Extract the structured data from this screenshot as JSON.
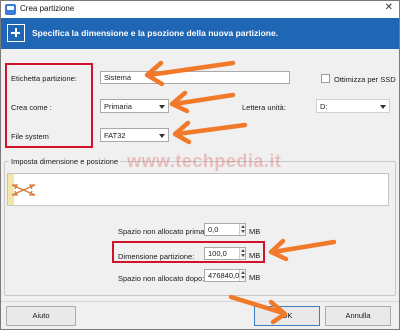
{
  "window": {
    "title": "Crea partizione"
  },
  "banner": {
    "text": "Specifica la dimensione e la psozione della nuova partizione."
  },
  "form": {
    "label_partition": "Etichetta partizione:",
    "label_partition_value": "Sistema",
    "ssd_label": "Ottimizza per SSD",
    "create_as_label": "Crea come :",
    "create_as_value": "Primaria",
    "drive_letter_label": "Lettera unità:",
    "drive_letter_value": "D:",
    "filesystem_label": "File system",
    "filesystem_value": "FAT32"
  },
  "size_group": {
    "title": "Imposta dimensione e posizione",
    "unalloc_before_label": "Spazio non allocato prima:",
    "unalloc_before_value": "0,0",
    "unalloc_before_unit": "MB",
    "partition_size_label": "Dimensione partizione:",
    "partition_size_value": "100,0",
    "partition_size_unit": "MB",
    "unalloc_after_label": "Spazio non allocato dopo:",
    "unalloc_after_value": "476840,0",
    "unalloc_after_unit": "MB"
  },
  "watermark": "www.techpedia.it",
  "buttons": {
    "help": "Aiuto",
    "ok": "OK",
    "cancel": "Annulla"
  },
  "colors": {
    "banner": "#1f66b5",
    "highlight": "#d0132b",
    "arrow": "#f07a2a"
  }
}
